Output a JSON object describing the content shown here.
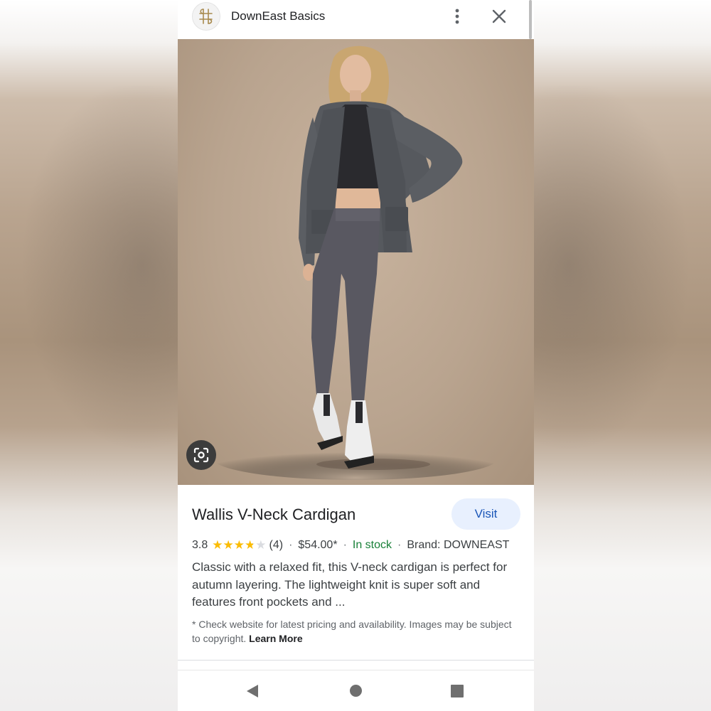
{
  "header": {
    "site_name": "DownEast Basics",
    "logo_icon": "downeast-monogram-logo",
    "more_icon": "more-vert-icon",
    "close_icon": "close-icon"
  },
  "image": {
    "alt": "Wallis V-Neck Cardigan",
    "lens_icon": "google-lens-icon"
  },
  "product": {
    "title": "Wallis V-Neck Cardigan",
    "visit_label": "Visit",
    "rating": "3.8",
    "rating_value": 3.8,
    "rating_max": 5,
    "review_count": "(4)",
    "price": "$54.00*",
    "availability": "In stock",
    "brand": "Brand: DOWNEAST",
    "separator": "·",
    "description": "Classic with a relaxed fit, this V-neck cardigan is perfect for autumn layering. The lightweight knit is super soft and features front pockets and ...",
    "disclaimer": "* Check website for latest pricing and availability. Images may be subject to copyright.",
    "learn_more": "Learn More"
  },
  "navbar": {
    "back_icon": "back-triangle-icon",
    "home_icon": "home-circle-icon",
    "recents_icon": "recents-square-icon"
  },
  "colors": {
    "accent": "#1a56b8",
    "visit_bg": "#e8f0fe",
    "in_stock": "#188038",
    "star": "#fbbc04",
    "star_empty": "#dadce0"
  }
}
